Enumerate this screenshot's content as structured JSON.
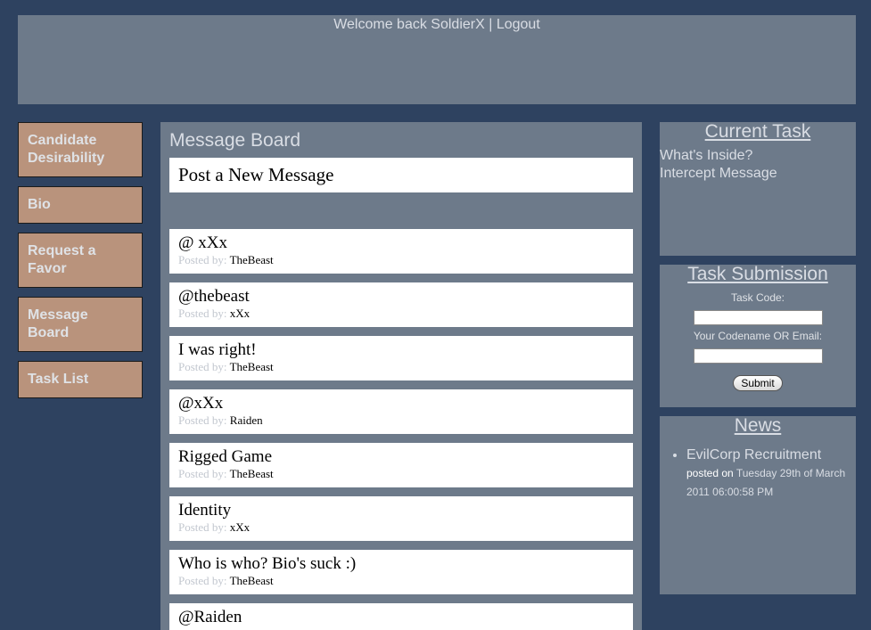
{
  "header": {
    "welcome_text": "Welcome back SoldierX",
    "separator": " | ",
    "logout_label": "Logout"
  },
  "nav": {
    "items": [
      {
        "label": "Candidate Desirability"
      },
      {
        "label": "Bio"
      },
      {
        "label": "Request a Favor"
      },
      {
        "label": "Message Board"
      },
      {
        "label": "Task List"
      }
    ]
  },
  "board": {
    "title": "Message Board",
    "post_new_label": "Post a New Message",
    "posted_by_label": "Posted by:",
    "messages": [
      {
        "title": "@ xXx",
        "author": "TheBeast"
      },
      {
        "title": "@thebeast",
        "author": "xXx"
      },
      {
        "title": "I was right!",
        "author": "TheBeast"
      },
      {
        "title": "@xXx",
        "author": "Raiden"
      },
      {
        "title": "Rigged Game",
        "author": "TheBeast"
      },
      {
        "title": "Identity",
        "author": "xXx"
      },
      {
        "title": "Who is who? Bio's suck :)",
        "author": "TheBeast"
      },
      {
        "title": "@Raiden",
        "author": ""
      }
    ]
  },
  "current_task": {
    "heading": "Current Task",
    "links": [
      "What's Inside?",
      "Intercept Message"
    ]
  },
  "task_submission": {
    "heading": "Task Submission",
    "code_label": "Task Code:",
    "code_value": "",
    "codename_label": "Your Codename OR Email:",
    "codename_value": "",
    "submit_label": "Submit"
  },
  "news": {
    "heading": "News",
    "items": [
      {
        "title": "EvilCorp Recruitment",
        "posted_on_label": "posted on",
        "date": "Tuesday 29th of March 2011 06:00:58 PM"
      }
    ]
  },
  "colors": {
    "background": "#2e4260",
    "panel": "#6d7a8a",
    "nav_item": "#b9937c"
  }
}
